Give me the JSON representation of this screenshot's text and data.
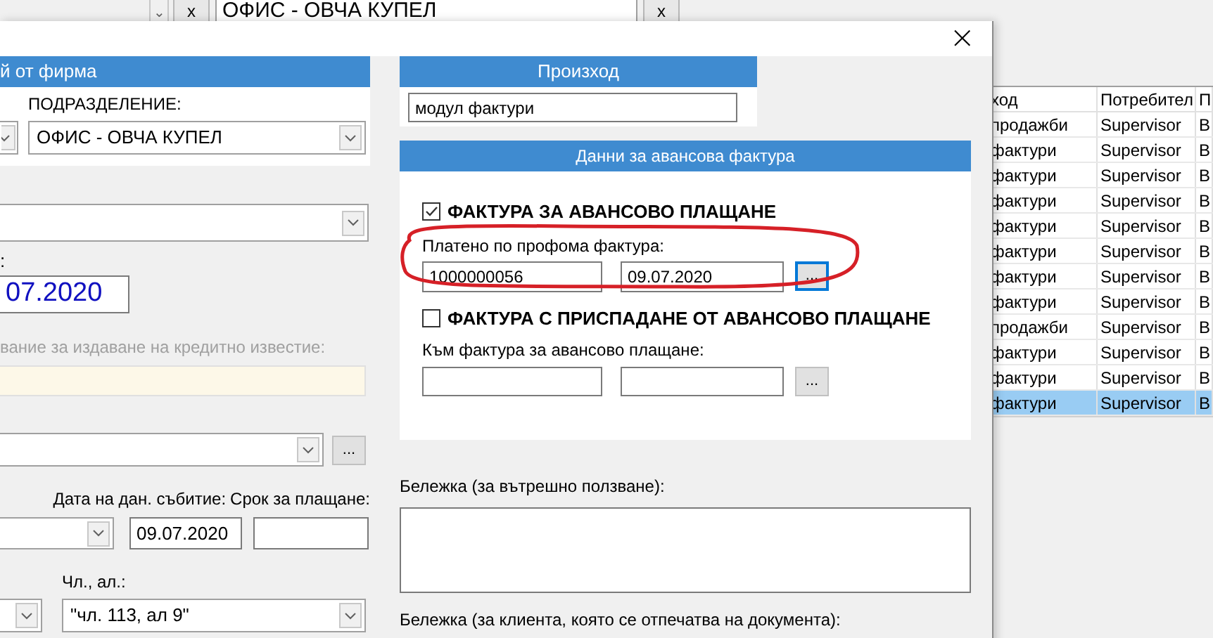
{
  "background_app": {
    "filter_combo_1": {
      "caret": "⌄"
    },
    "clear_buttons": [
      "x",
      "x"
    ],
    "filter_combo_2": {
      "value": "ОФИС - ОВЧА КУПЕЛ"
    },
    "table": {
      "columns": [
        "ход",
        "Потребител",
        "П"
      ],
      "rows": [
        {
          "cells": [
            "продажби",
            "Supervisor",
            "В"
          ],
          "selected": false
        },
        {
          "cells": [
            "фактури",
            "Supervisor",
            "В"
          ],
          "selected": false
        },
        {
          "cells": [
            "фактури",
            "Supervisor",
            "В"
          ],
          "selected": false
        },
        {
          "cells": [
            "фактури",
            "Supervisor",
            "В"
          ],
          "selected": false
        },
        {
          "cells": [
            "фактури",
            "Supervisor",
            "В"
          ],
          "selected": false
        },
        {
          "cells": [
            "фактури",
            "Supervisor",
            "В"
          ],
          "selected": false
        },
        {
          "cells": [
            "фактури",
            "Supervisor",
            "В"
          ],
          "selected": false
        },
        {
          "cells": [
            "фактури",
            "Supervisor",
            "В"
          ],
          "selected": false
        },
        {
          "cells": [
            "продажби",
            "Supervisor",
            "В"
          ],
          "selected": false
        },
        {
          "cells": [
            "фактури",
            "Supervisor",
            "В"
          ],
          "selected": false
        },
        {
          "cells": [
            "фактури",
            "Supervisor",
            "В"
          ],
          "selected": false
        },
        {
          "cells": [
            "фактури",
            "Supervisor",
            "В"
          ],
          "selected": true
        }
      ]
    }
  },
  "dialog": {
    "close": "×",
    "left": {
      "header": "й от фирма",
      "division_label": "ПОДРАЗДЕЛЕНИЕ:",
      "division": "ОФИС - ОВЧА КУПЕЛ",
      "date_label": ":",
      "date": "07.2020",
      "credit_note_label": "вание за издаване на кредитно известие:",
      "tax_event_label": "Дата на дан. събитие:",
      "due_label": "Срок за плащане:",
      "tax_event_date": "09.07.2020",
      "article_label": "Чл., ал.:",
      "article": "\"чл. 113, ал 9\"",
      "browse": "..."
    },
    "right": {
      "origin_header": "Произход",
      "origin": "модул фактури",
      "advance_header": "Данни за авансова фактура",
      "advance_invoice": {
        "label": "ФАКТУРА ЗА АВАНСОВО ПЛАЩАНЕ",
        "checked": true
      },
      "proforma_label": "Платено по профома фактура:",
      "proforma_number": "1000000056",
      "proforma_date": "09.07.2020",
      "proforma_browse": "...",
      "deduction": {
        "label": "ФАКТУРА С ПРИСПАДАНЕ ОТ АВАНСОВО ПЛАЩАНЕ",
        "checked": false
      },
      "to_advance_label": "Към фактура за авансово плащане:",
      "to_advance_browse": "...",
      "internal_note_label": "Бележка (за вътрешно ползване):",
      "client_note_label": "Бележка (за клиента, която се отпечатва на документа):"
    }
  }
}
